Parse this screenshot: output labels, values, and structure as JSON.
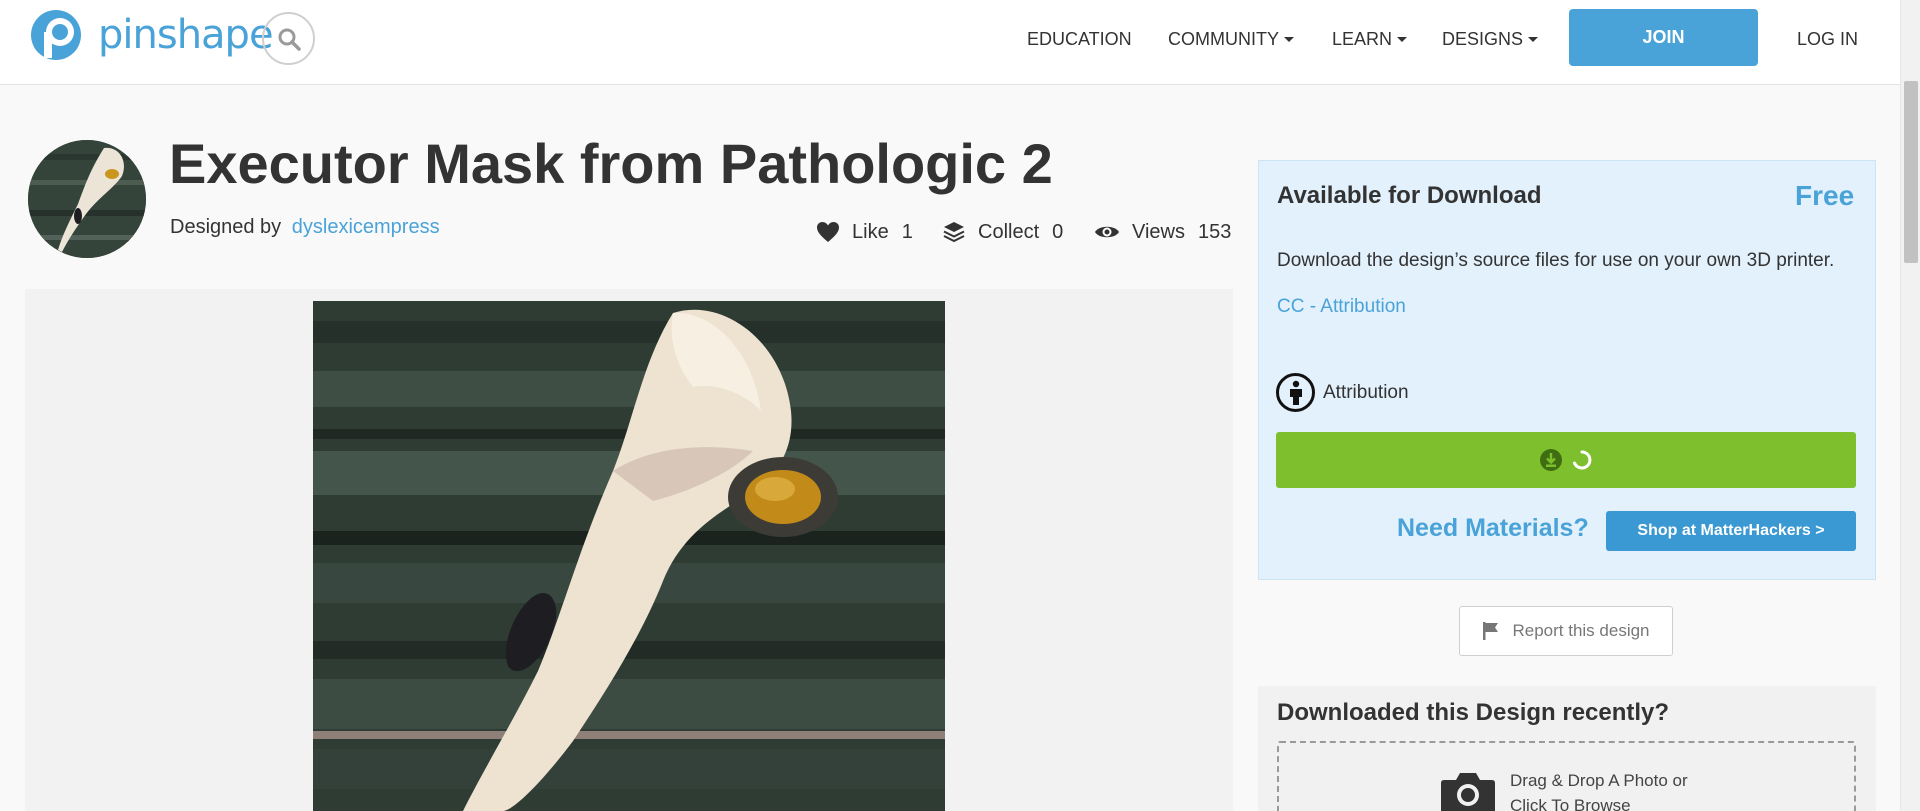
{
  "header": {
    "logo_text": "pinshape",
    "nav": {
      "education": "EDUCATION",
      "community": "COMMUNITY",
      "learn": "LEARN",
      "designs": "DESIGNS"
    },
    "join_label": "JOIN",
    "login_label": "LOG IN"
  },
  "design": {
    "title": "Executor Mask from Pathologic 2",
    "designed_by_label": "Designed by",
    "designer": "dyslexicempress",
    "stats": {
      "like_label": "Like",
      "like_count": "1",
      "collect_label": "Collect",
      "collect_count": "0",
      "views_label": "Views",
      "views_count": "153"
    }
  },
  "download": {
    "title": "Available for Download",
    "price": "Free",
    "description": "Download the design’s source files for use on your own 3D printer.",
    "license": "CC - Attribution",
    "attribution_label": "Attribution",
    "need_materials": "Need Materials?",
    "shop_label": "Shop at MatterHackers >"
  },
  "report_label": "Report this design",
  "recent": {
    "title": "Downloaded this Design recently?",
    "drop_line1": "Drag & Drop A Photo or",
    "drop_line2": "Click To Browse"
  },
  "colors": {
    "brand_blue": "#4aa3d8",
    "download_green": "#7dbf2d",
    "panel_blue": "#e2f1fb"
  },
  "icons": [
    "pinshape-logo-icon",
    "search-icon",
    "heart-icon",
    "layers-icon",
    "eye-icon",
    "attribution-person-icon",
    "download-icon",
    "loading-spinner-icon",
    "flag-icon",
    "camera-icon"
  ]
}
